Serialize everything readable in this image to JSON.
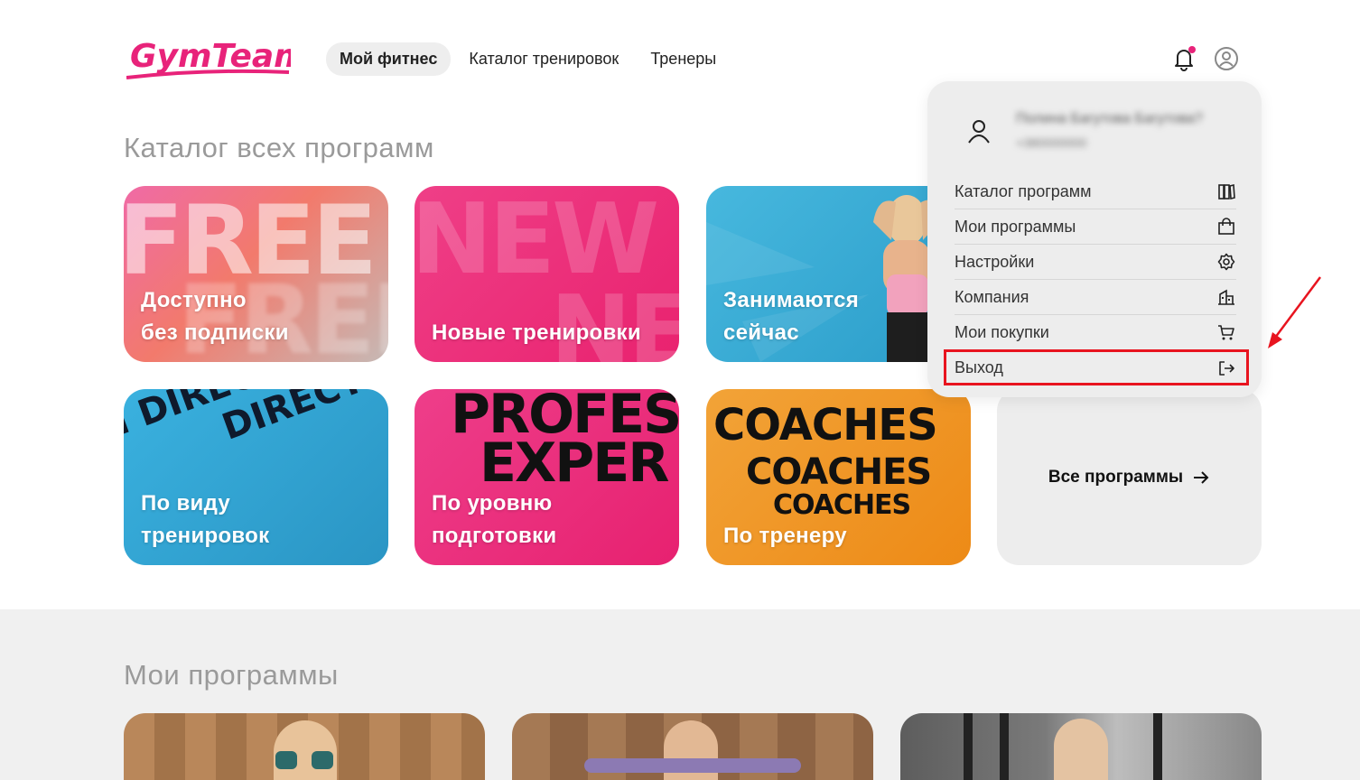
{
  "header": {
    "logo_text": "GymTeam",
    "nav": [
      {
        "label": "Мой фитнес",
        "active": true
      },
      {
        "label": "Каталог тренировок",
        "active": false
      },
      {
        "label": "Тренеры",
        "active": false
      }
    ],
    "icons": [
      "bell-icon",
      "user-icon"
    ],
    "notification_dot_color": "#e8237a"
  },
  "catalog": {
    "title": "Каталог всех программ",
    "cards": [
      {
        "label_line1": "Доступно",
        "label_line2": "без подписки",
        "bg_text": "FREE"
      },
      {
        "label_line1": "Новые тренировки",
        "label_line2": "",
        "bg_text": "NEW"
      },
      {
        "label_line1": "Занимаются",
        "label_line2": "сейчас",
        "bg_text": ""
      },
      {
        "label_line1": "По виду",
        "label_line2": "тренировок",
        "bg_text": "DIRECTION"
      },
      {
        "label_line1": "По уровню",
        "label_line2": "подготовки",
        "bg_text_1": "PROFES",
        "bg_text_2": "EXPER"
      },
      {
        "label_line1": "По тренеру",
        "label_line2": "",
        "bg_text": "COACHES"
      }
    ],
    "all_programs_label": "Все программы"
  },
  "my_programs": {
    "title": "Мои программы"
  },
  "user_menu": {
    "name_blurred": "Полина Багутова Багутова?",
    "subtitle_blurred": "+380000000",
    "items": [
      {
        "label": "Каталог программ",
        "icon": "books-icon"
      },
      {
        "label": "Мои программы",
        "icon": "bag-icon"
      },
      {
        "label": "Настройки",
        "icon": "gear-icon"
      },
      {
        "label": "Компания",
        "icon": "building-icon"
      },
      {
        "label": "Мои покупки",
        "icon": "cart-icon"
      },
      {
        "label": "Выход",
        "icon": "logout-icon"
      }
    ]
  },
  "colors": {
    "brand_pink": "#e8237a",
    "highlight_red": "#e8141f"
  }
}
